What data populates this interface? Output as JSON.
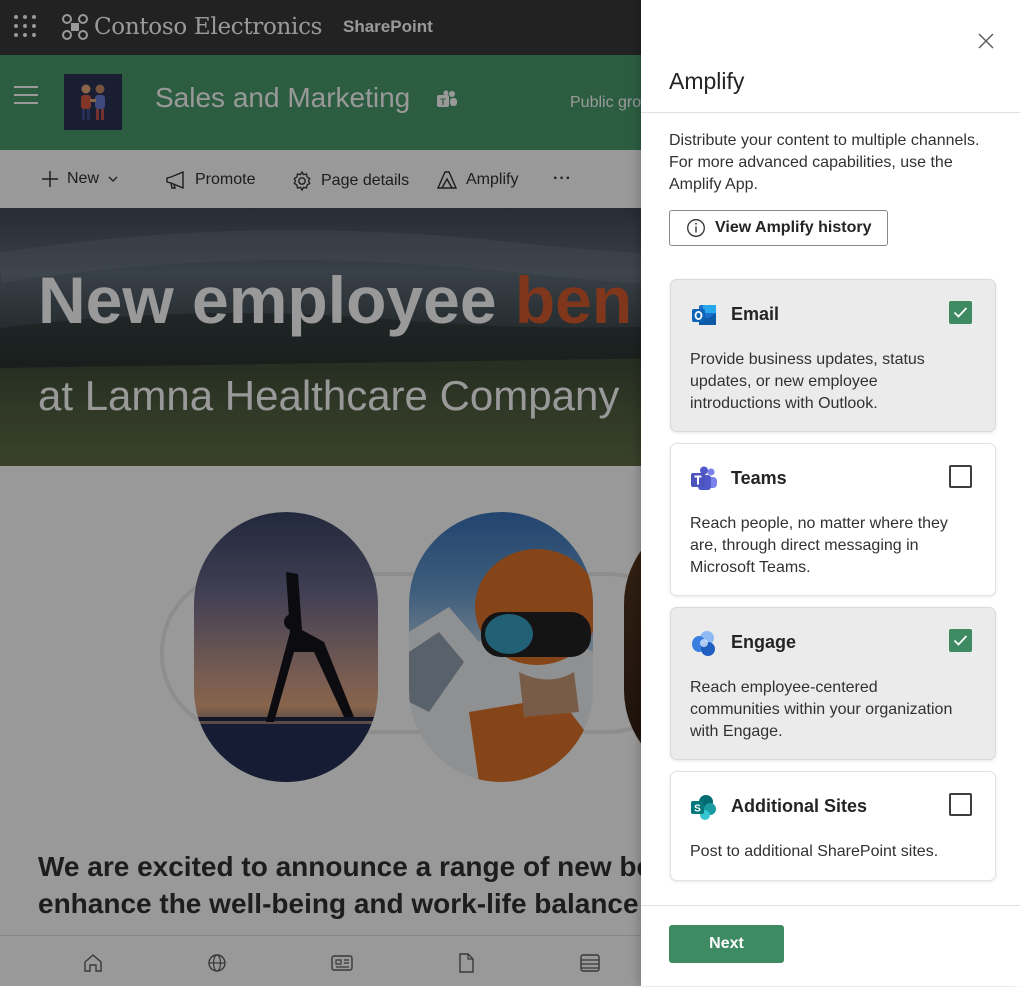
{
  "suite": {
    "brand": "Contoso Electronics",
    "app": "SharePoint"
  },
  "site": {
    "title": "Sales and Marketing",
    "group_type": "Public gro"
  },
  "commands": {
    "new": "New",
    "promote": "Promote",
    "page_details": "Page details",
    "amplify": "Amplify",
    "more": "···"
  },
  "hero": {
    "title_main": "New employee ",
    "title_accent": "ben",
    "subtitle": "at Lamna Healthcare Company"
  },
  "body": {
    "announcement_line1": "We are excited to announce a range of new be",
    "announcement_line2": "enhance the well-being and work-life balance"
  },
  "nav": {
    "icons": [
      "home-icon",
      "globe-icon",
      "news-icon",
      "file-icon",
      "list-icon"
    ]
  },
  "colors": {
    "site_header": "#4a9c6d",
    "accent": "#3e8a63",
    "hero_accent": "#d65a2d",
    "suite_bar": "#3b3a39"
  },
  "panel": {
    "title": "Amplify",
    "description": "Distribute your content to multiple channels. For more advanced capabilities, use the Amplify App.",
    "history_button": "View Amplify history",
    "next_button": "Next",
    "channels": [
      {
        "title": "Email",
        "description": "Provide business updates, status updates, or new employee introductions with Outlook.",
        "checked": true,
        "icon": "outlook-icon"
      },
      {
        "title": "Teams",
        "description": "Reach people, no matter where they are, through direct messaging in Microsoft Teams.",
        "checked": false,
        "icon": "teams-icon"
      },
      {
        "title": "Engage",
        "description": "Reach employee-centered communities within your organization with Engage.",
        "checked": true,
        "icon": "engage-icon"
      },
      {
        "title": "Additional Sites",
        "description": "Post to additional SharePoint sites.",
        "checked": false,
        "icon": "sharepoint-icon"
      }
    ]
  }
}
